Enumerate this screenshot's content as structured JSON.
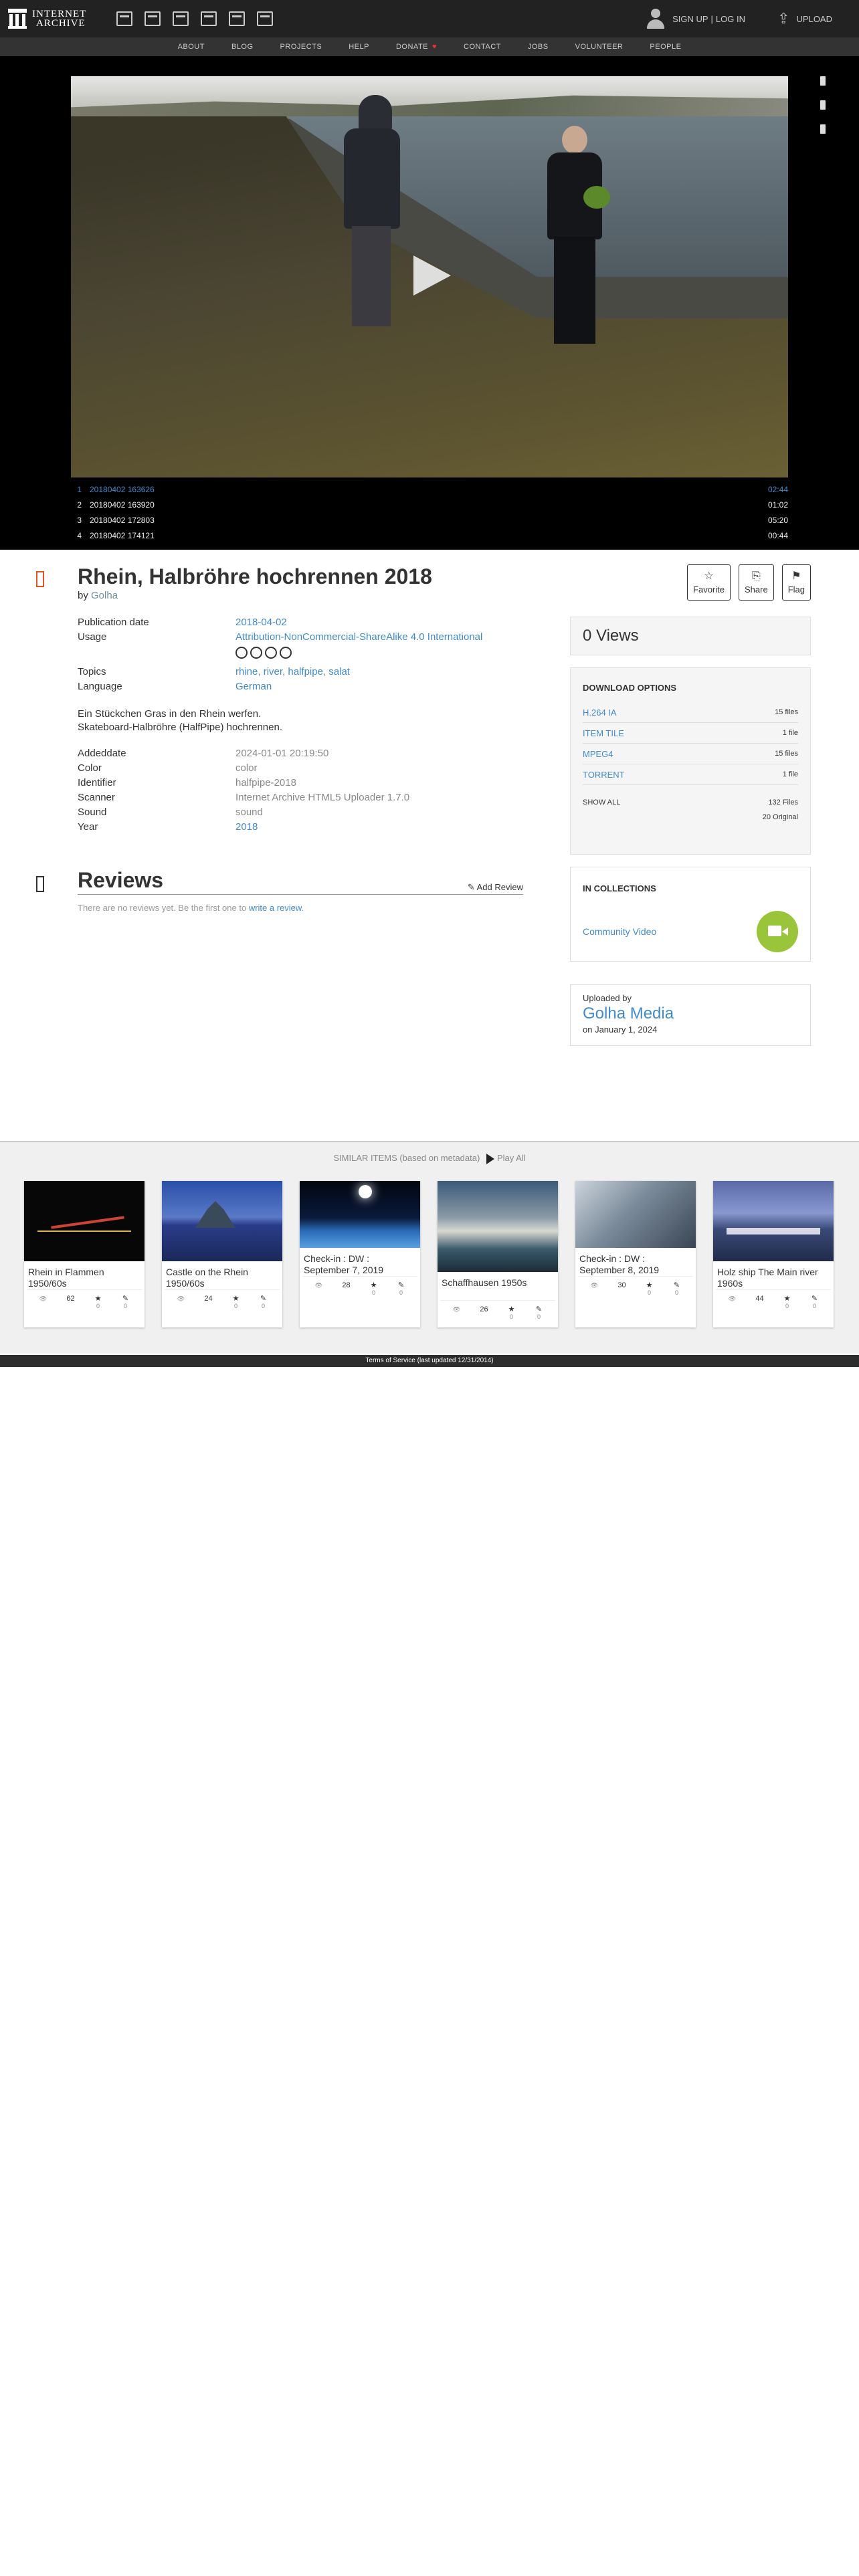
{
  "brand": {
    "line1": "INTERNET",
    "line2": "ARCHIVE"
  },
  "topnav": {
    "media_icons": [
      "web-icon",
      "texts-icon",
      "video-icon",
      "audio-icon",
      "software-icon",
      "images-icon"
    ],
    "signup": "SIGN UP",
    "separator": "|",
    "login": "LOG IN",
    "upload": "UPLOAD"
  },
  "subnav": [
    "ABOUT",
    "BLOG",
    "PROJECTS",
    "HELP",
    "DONATE",
    "CONTACT",
    "JOBS",
    "VOLUNTEER",
    "PEOPLE"
  ],
  "playlist": [
    {
      "n": "1",
      "title": "20180402 163626",
      "dur": "02:44"
    },
    {
      "n": "2",
      "title": "20180402 163920",
      "dur": "01:02"
    },
    {
      "n": "3",
      "title": "20180402 172803",
      "dur": "05:20"
    },
    {
      "n": "4",
      "title": "20180402 174121",
      "dur": "00:44"
    }
  ],
  "item": {
    "title": "Rhein, Halbröhre hochrennen 2018",
    "by_label": "by",
    "by": "Golha",
    "actions": {
      "favorite": "Favorite",
      "share": "Share",
      "flag": "Flag"
    }
  },
  "meta": {
    "pubdate_k": "Publication date",
    "pubdate_v": "2018-04-02",
    "usage_k": "Usage",
    "usage_v": "Attribution-NonCommercial-ShareAlike 4.0 International",
    "topics_k": "Topics",
    "topics": [
      "rhine",
      "river",
      "halfpipe",
      "salat"
    ],
    "language_k": "Language",
    "language_v": "German",
    "desc1": "Ein Stückchen Gras in den Rhein werfen.",
    "desc2": "Skateboard-Halbröhre (HalfPipe) hochrennen.",
    "addeddate_k": "Addeddate",
    "addeddate_v": "2024-01-01 20:19:50",
    "color_k": "Color",
    "color_v": "color",
    "identifier_k": "Identifier",
    "identifier_v": "halfpipe-2018",
    "scanner_k": "Scanner",
    "scanner_v": "Internet Archive HTML5 Uploader 1.7.0",
    "sound_k": "Sound",
    "sound_v": "sound",
    "year_k": "Year",
    "year_v": "2018"
  },
  "reviews": {
    "title": "Reviews",
    "add": "Add Review",
    "empty_prefix": "There are no reviews yet. Be the first one to",
    "empty_link": "write a review",
    "empty_suffix": "."
  },
  "views": "0 Views",
  "downloads": {
    "heading": "DOWNLOAD OPTIONS",
    "rows": [
      {
        "label": "H.264 IA",
        "count": "15 files"
      },
      {
        "label": "ITEM TILE",
        "count": "1 file"
      },
      {
        "label": "MPEG4",
        "count": "15 files"
      },
      {
        "label": "TORRENT",
        "count": "1 file"
      }
    ],
    "show_all": "SHOW ALL",
    "total": "132 Files",
    "original": "20 Original"
  },
  "collections": {
    "heading": "IN COLLECTIONS",
    "name": "Community Video"
  },
  "uploader": {
    "label": "Uploaded by",
    "name": "Golha Media",
    "date": "on January 1, 2024"
  },
  "similar": {
    "heading": "SIMILAR ITEMS (based on metadata)",
    "play_all": "Play All",
    "items": [
      {
        "title": "Rhein in Flammen 1950/60s",
        "views": "62",
        "favs": "0",
        "reviews": "0",
        "tall": true
      },
      {
        "title": "Castle on the Rhein 1950/60s",
        "views": "24",
        "favs": "0",
        "reviews": "0",
        "tall": true
      },
      {
        "title": "Check-in : DW : September 7, 2019",
        "views": "28",
        "favs": "0",
        "reviews": "0",
        "tall": false
      },
      {
        "title": "Schaffhausen 1950s",
        "views": "26",
        "favs": "0",
        "reviews": "0",
        "tall": true
      },
      {
        "title": "Check-in : DW : September 8, 2019",
        "views": "30",
        "favs": "0",
        "reviews": "0",
        "tall": false
      },
      {
        "title": "Holz ship The Main river 1960s",
        "views": "44",
        "favs": "0",
        "reviews": "0",
        "tall": true
      }
    ]
  },
  "footer": "Terms of Service (last updated 12/31/2014)"
}
